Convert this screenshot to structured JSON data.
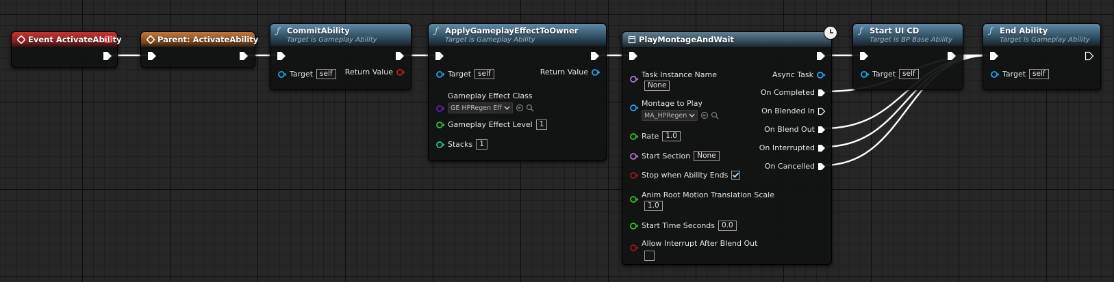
{
  "nodes": {
    "event_activate": {
      "title": "Event ActivateAbility"
    },
    "parent_activate": {
      "title": "Parent: ActivateAbility"
    },
    "commit_ability": {
      "title": "CommitAbility",
      "subtitle": "Target is Gameplay Ability",
      "target_label": "Target",
      "target_value": "self",
      "return_label": "Return Value"
    },
    "apply_effect": {
      "title": "ApplyGameplayEffectToOwner",
      "subtitle": "Target is Gameplay Ability",
      "target_label": "Target",
      "target_value": "self",
      "return_label": "Return Value",
      "effect_class_label": "Gameplay Effect Class",
      "effect_class_value": "GE HPRegen Eff",
      "effect_level_label": "Gameplay Effect Level",
      "effect_level_value": "1",
      "stacks_label": "Stacks",
      "stacks_value": "1"
    },
    "play_montage": {
      "title": "PlayMontageAndWait",
      "task_instance_label": "Task Instance Name",
      "task_instance_value": "None",
      "montage_label": "Montage to Play",
      "montage_value": "MA_HPRegen",
      "rate_label": "Rate",
      "rate_value": "1.0",
      "start_section_label": "Start Section",
      "start_section_value": "None",
      "stop_when_label": "Stop when Ability Ends",
      "stop_when_checked": true,
      "anim_root_label": "Anim Root Motion Translation Scale",
      "anim_root_value": "1.0",
      "start_time_label": "Start Time Seconds",
      "start_time_value": "0.0",
      "allow_interrupt_label": "Allow Interrupt After Blend Out",
      "allow_interrupt_checked": false,
      "outputs": {
        "async_task": "Async Task",
        "on_completed": "On Completed",
        "on_blended_in": "On Blended In",
        "on_blend_out": "On Blend Out",
        "on_interrupted": "On Interrupted",
        "on_cancelled": "On Cancelled"
      }
    },
    "start_ui_cd": {
      "title": "Start UI CD",
      "subtitle": "Target is BP Base Ability",
      "target_label": "Target",
      "target_value": "self"
    },
    "end_ability": {
      "title": "End Ability",
      "subtitle": "Target is Gameplay Ability",
      "target_label": "Target",
      "target_value": "self"
    }
  },
  "colors": {
    "exec": "#ffffff",
    "object_pin": "#1fa8e6",
    "bool_pin": "#9a1a1a",
    "float_pin": "#33c435",
    "int_pin": "#1fc3a0",
    "class_pin": "#6a1fb8",
    "name_pin": "#b07ad6",
    "event_header": "#c53534",
    "parent_header": "#c4783a",
    "function_header": "#5f8aa4"
  }
}
